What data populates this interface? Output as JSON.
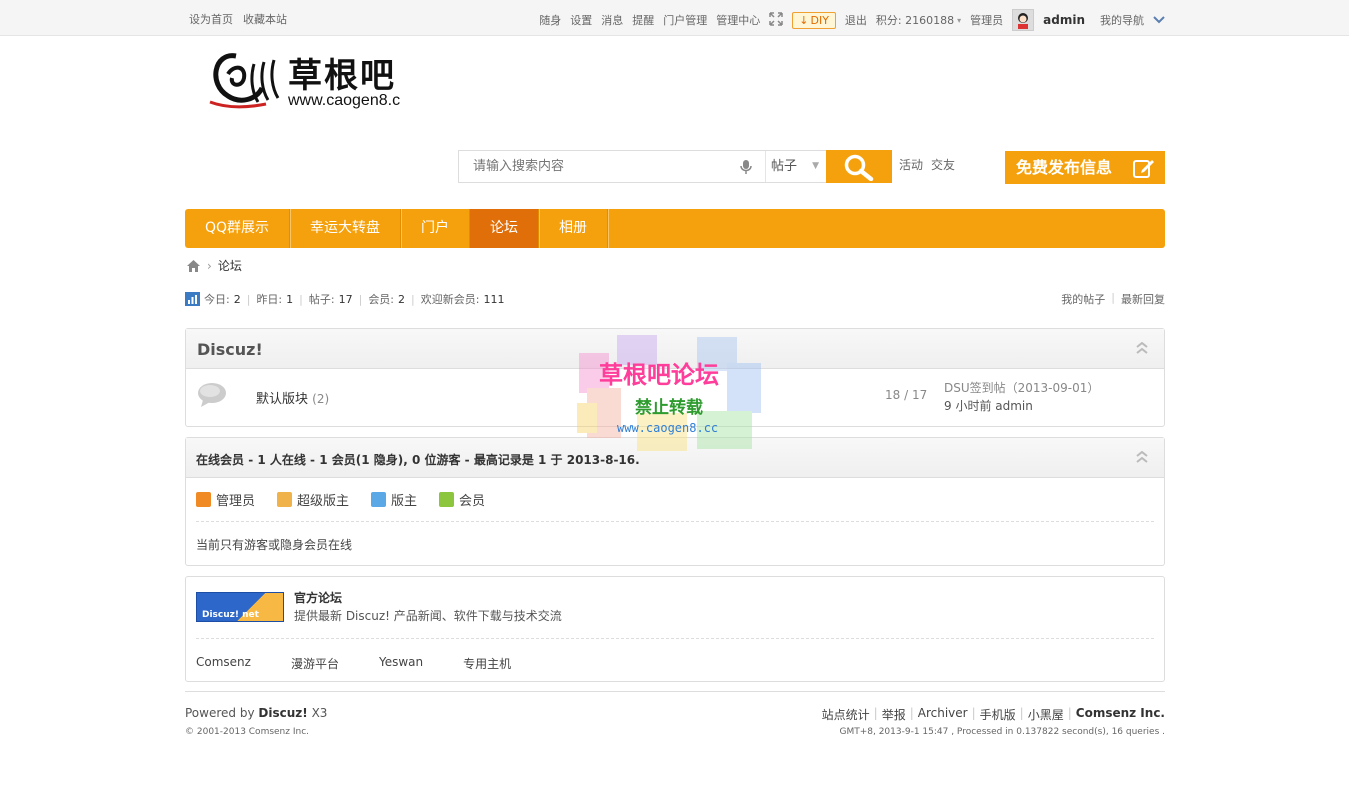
{
  "topbar": {
    "left_links": [
      "设为首页",
      "收藏本站"
    ],
    "right_links": [
      "随身",
      "设置",
      "消息",
      "提醒",
      "门户管理",
      "管理中心"
    ],
    "diy_label": "DIY",
    "logout": "退出",
    "credits": "积分: 2160188",
    "role": "管理员",
    "username": "admin",
    "my_nav": "我的导航"
  },
  "header": {
    "logo_text": "草根吧",
    "logo_url": "www.caogen8.c",
    "search": {
      "placeholder": "请输入搜索内容",
      "type": "帖子"
    },
    "hot_links": [
      "活动",
      "交友"
    ],
    "publish_label": "免费发布信息"
  },
  "nav": {
    "items": [
      "QQ群展示",
      "幸运大转盘",
      "门户",
      "论坛",
      "相册"
    ],
    "active_index": 3
  },
  "breadcrumb": {
    "current": "论坛"
  },
  "stats": {
    "today_label": "今日:",
    "today": "2",
    "yesterday_label": "昨日:",
    "yesterday": "1",
    "posts_label": "帖子:",
    "posts": "17",
    "members_label": "会员:",
    "members": "2",
    "newest_label": "欢迎新会员:",
    "newest": "111",
    "right_links": [
      "我的帖子",
      "最新回复"
    ]
  },
  "category": {
    "title": "Discuz!",
    "forum": {
      "name": "默认版块",
      "today_count": "(2)",
      "counts": "18 / 17",
      "last_post": "DSU签到帖（2013-09-01）",
      "last_time": "9 小时前 admin"
    }
  },
  "online": {
    "label": "在线会员",
    "summary": " - 1 人在线 - 1 会员(1 隐身), 0 位游客 - 最高记录是 1 于 2013-8-16.",
    "legend": [
      "管理员",
      "超级版主",
      "版主",
      "会员"
    ],
    "note": "当前只有游客或隐身会员在线"
  },
  "links": {
    "badge": "Discuz! net",
    "title": "官方论坛",
    "desc": "提供最新 Discuz! 产品新闻、软件下载与技术交流",
    "items": [
      "Comsenz",
      "漫游平台",
      "Yeswan",
      "专用主机"
    ]
  },
  "footer": {
    "powered_prefix": "Powered by",
    "powered_name": "Discuz!",
    "powered_ver": "X3",
    "copyright": "© 2001-2013 Comsenz Inc.",
    "links": [
      "站点统计",
      "举报",
      "Archiver",
      "手机版",
      "小黑屋"
    ],
    "company": "Comsenz Inc.",
    "gmt": "GMT+8, 2013-9-1 15:47 , Processed in 0.137822 second(s), 16 queries ."
  },
  "watermark": {
    "title": "草根吧论坛",
    "sub": "禁止转载",
    "url": "www.caogen8.cc"
  },
  "colors": {
    "accent": "#f5a10d",
    "nav_active": "#e06f0a"
  }
}
